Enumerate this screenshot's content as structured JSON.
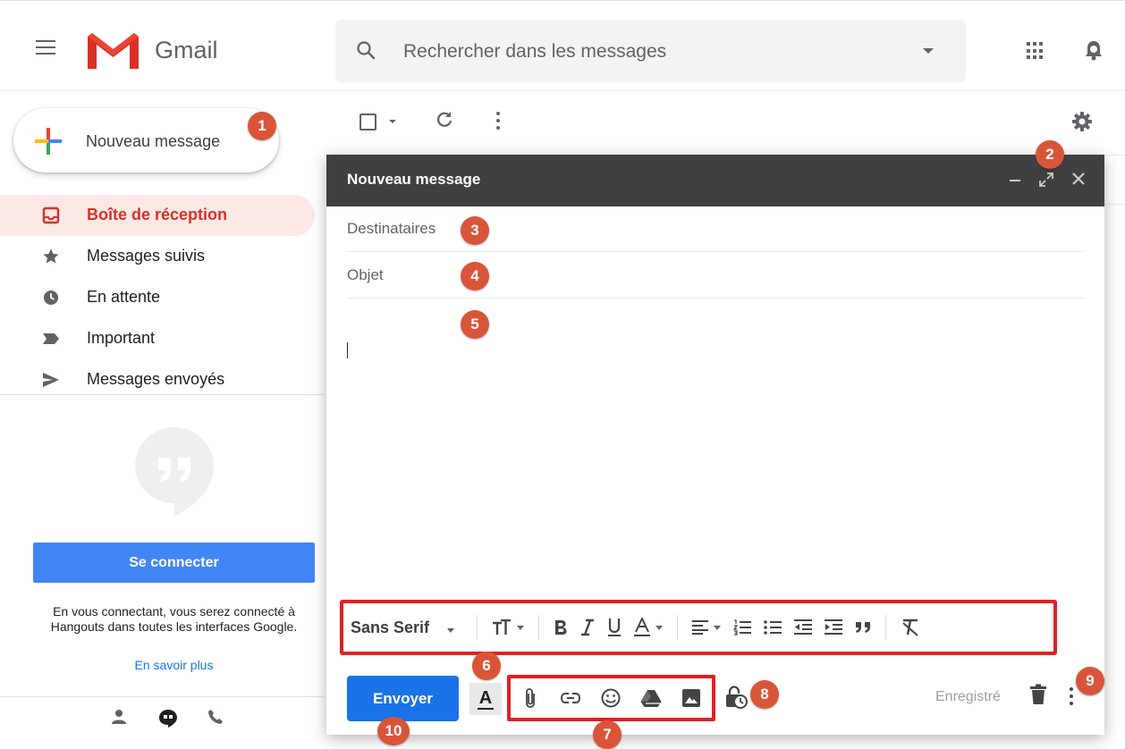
{
  "header": {
    "brand": "Gmail",
    "search_placeholder": "Rechercher dans les messages"
  },
  "sidebar": {
    "compose_label": "Nouveau message",
    "items": [
      {
        "label": "Boîte de réception",
        "icon": "inbox-icon",
        "active": true
      },
      {
        "label": "Messages suivis",
        "icon": "star-icon"
      },
      {
        "label": "En attente",
        "icon": "clock-icon"
      },
      {
        "label": "Important",
        "icon": "important-icon"
      },
      {
        "label": "Messages envoyés",
        "icon": "send-icon"
      }
    ],
    "hangouts": {
      "signin_label": "Se connecter",
      "text": "En vous connectant, vous serez connecté à Hangouts dans toutes les interfaces Google.",
      "learn_more": "En savoir plus"
    }
  },
  "compose": {
    "title": "Nouveau message",
    "to_label": "Destinataires",
    "subject_label": "Objet",
    "font_name": "Sans Serif",
    "send_label": "Envoyer",
    "saved_label": "Enregistré"
  },
  "badges": [
    "1",
    "2",
    "3",
    "4",
    "5",
    "6",
    "7",
    "8",
    "9",
    "10"
  ],
  "colors": {
    "accent_red": "#d93025",
    "badge": "#d9553a",
    "highlight_box": "#e21f26",
    "send_blue": "#1a73e8",
    "signin_blue": "#4285f4",
    "compose_header": "#404040"
  }
}
